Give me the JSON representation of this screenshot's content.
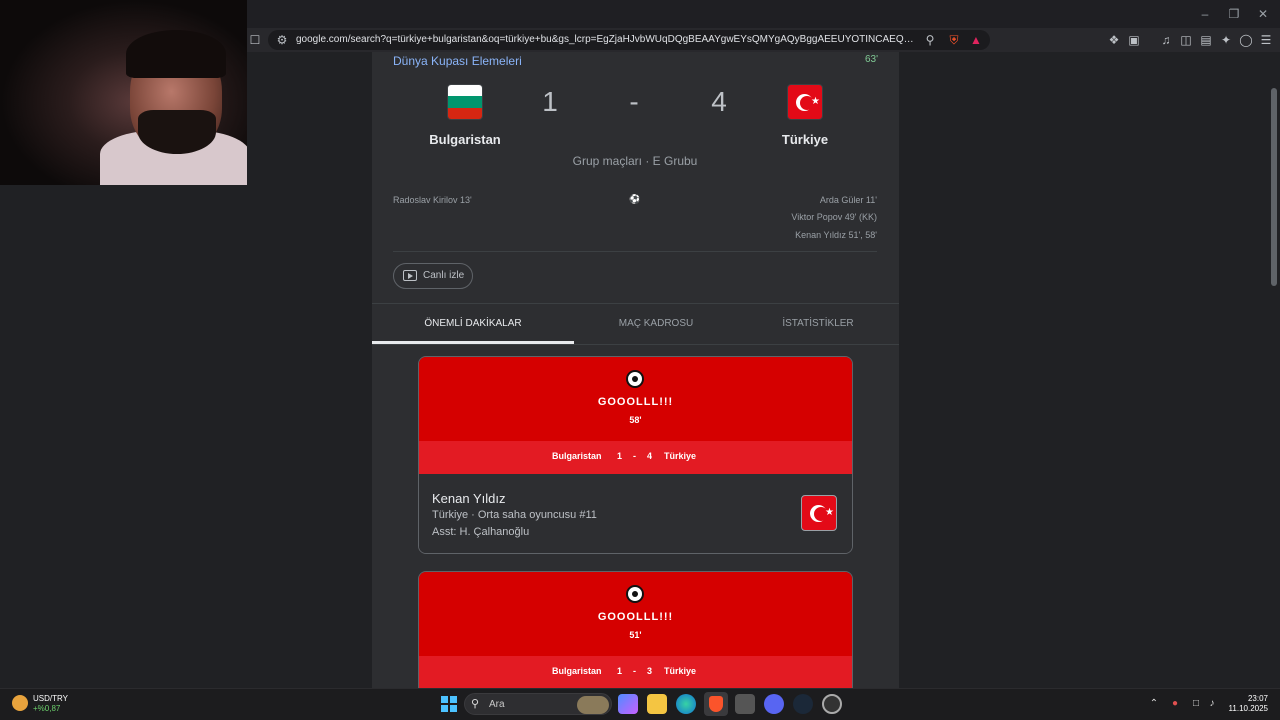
{
  "browser": {
    "url": "google.com/search?q=türkiye+bulgaristan&oq=türkiye+bu&gs_lcrp=EgZjaHJvbWUqDQgBEAAYgwEYsQMYgAQyBggAEEUYOTINCAEQABiDARixAxiAB..."
  },
  "match": {
    "competition": "Dünya Kupası Elemeleri",
    "minute": "63'",
    "home_team": "Bulgaristan",
    "away_team": "Türkiye",
    "home_score": "1",
    "separator": "-",
    "away_score": "4",
    "group": "Grup maçları · E Grubu",
    "home_scorers": [
      "Radoslav Kirilov 13'"
    ],
    "away_scorers": [
      "Arda Güler 11'",
      "Viktor Popov 49' (KK)",
      "Kenan Yıldız 51', 58'"
    ],
    "live_label": "Canlı izle"
  },
  "tabs": [
    {
      "label": "ÖNEMLİ DAKİKALAR",
      "active": true
    },
    {
      "label": "MAÇ KADROSU",
      "active": false
    },
    {
      "label": "İSTATİSTİKLER",
      "active": false
    }
  ],
  "goals": [
    {
      "title": "GOOOLLL!!!",
      "minute": "58'",
      "home": "Bulgaristan",
      "home_score": "1",
      "sep": "-",
      "away_score": "4",
      "away": "Türkiye",
      "player": "Kenan Yıldız",
      "info": "Türkiye · Orta saha oyuncusu #11",
      "assist": "Asst: H. Çalhanoğlu"
    },
    {
      "title": "GOOOLLL!!!",
      "minute": "51'",
      "home": "Bulgaristan",
      "home_score": "1",
      "sep": "-",
      "away_score": "3",
      "away": "Türkiye"
    }
  ],
  "taskbar": {
    "ticker_name": "USD/TRY",
    "ticker_value": "+%0,87",
    "search_placeholder": "Ara",
    "time": "23:07",
    "date": "11.10.2025"
  },
  "colors": {
    "goal_red": "#d50000",
    "band_red": "#e31b23",
    "link_blue": "#8ab4f8",
    "live_green": "#81c995"
  }
}
